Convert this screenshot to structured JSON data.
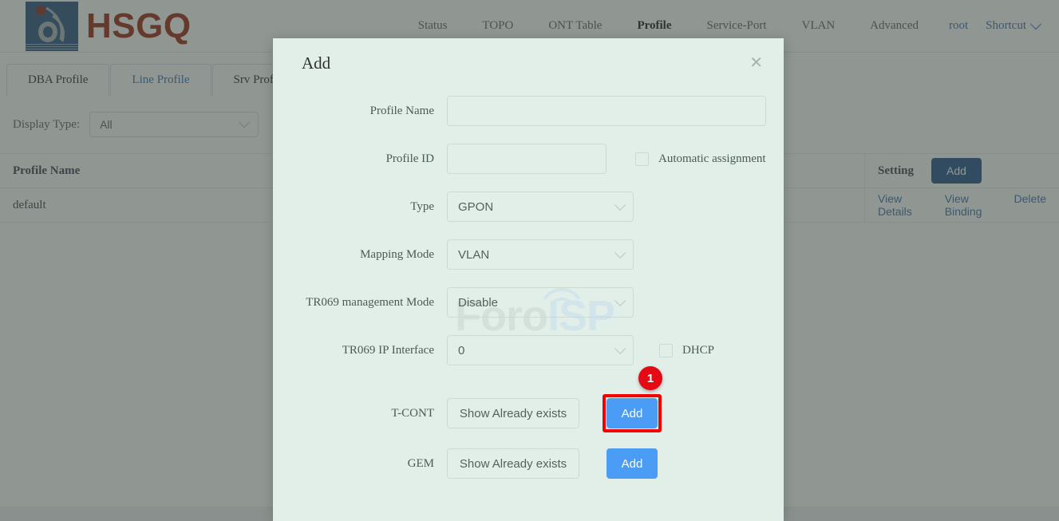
{
  "header": {
    "logo_text": "HSGQ",
    "nav_items": [
      {
        "label": "Status",
        "active": false
      },
      {
        "label": "TOPO",
        "active": false
      },
      {
        "label": "ONT Table",
        "active": false
      },
      {
        "label": "Profile",
        "active": true
      },
      {
        "label": "Service-Port",
        "active": false
      },
      {
        "label": "VLAN",
        "active": false
      },
      {
        "label": "Advanced",
        "active": false
      }
    ],
    "user": "root",
    "shortcut": "Shortcut"
  },
  "tabs": [
    {
      "label": "DBA Profile",
      "active": false
    },
    {
      "label": "Line Profile",
      "active": true
    },
    {
      "label": "Srv Profile",
      "active": false
    }
  ],
  "filter": {
    "label": "Display Type:",
    "display_type_value": "All"
  },
  "table": {
    "columns": [
      "Profile Name",
      "Setting"
    ],
    "add_button": "Add",
    "rows": [
      {
        "profile_name": "default",
        "actions": [
          "View Details",
          "View Binding",
          "Delete"
        ]
      }
    ]
  },
  "modal": {
    "title": "Add",
    "close_icon": "close-icon",
    "watermark": {
      "part1": "Foro",
      "part2": "ISP"
    },
    "fields": {
      "profile_name": {
        "label": "Profile Name",
        "value": "",
        "placeholder": ""
      },
      "profile_id": {
        "label": "Profile ID",
        "value": "",
        "placeholder": ""
      },
      "automatic_assignment": {
        "label": "Automatic assignment",
        "checked": false
      },
      "type": {
        "label": "Type",
        "value": "GPON"
      },
      "mapping_mode": {
        "label": "Mapping Mode",
        "value": "VLAN"
      },
      "tr069_management_mode": {
        "label": "TR069 management Mode",
        "value": "Disable"
      },
      "tr069_ip_interface": {
        "label": "TR069 IP Interface",
        "value": "0"
      },
      "dhcp": {
        "label": "DHCP",
        "checked": false
      },
      "tcont": {
        "label": "T-CONT",
        "show_button": "Show Already exists",
        "add_button": "Add"
      },
      "gem": {
        "label": "GEM",
        "show_button": "Show Already exists",
        "add_button": "Add"
      }
    },
    "annotation": {
      "badge_number": "1",
      "target": "tcont-add-button"
    }
  },
  "colors": {
    "brand_red": "#9b2b16",
    "brand_blue": "#2b5580",
    "link_blue": "#3d6fb4",
    "primary_blue": "#4a9cf5",
    "modal_bg": "#e2efe8",
    "highlight_red": "#f20000",
    "badge_red": "#e50914"
  }
}
